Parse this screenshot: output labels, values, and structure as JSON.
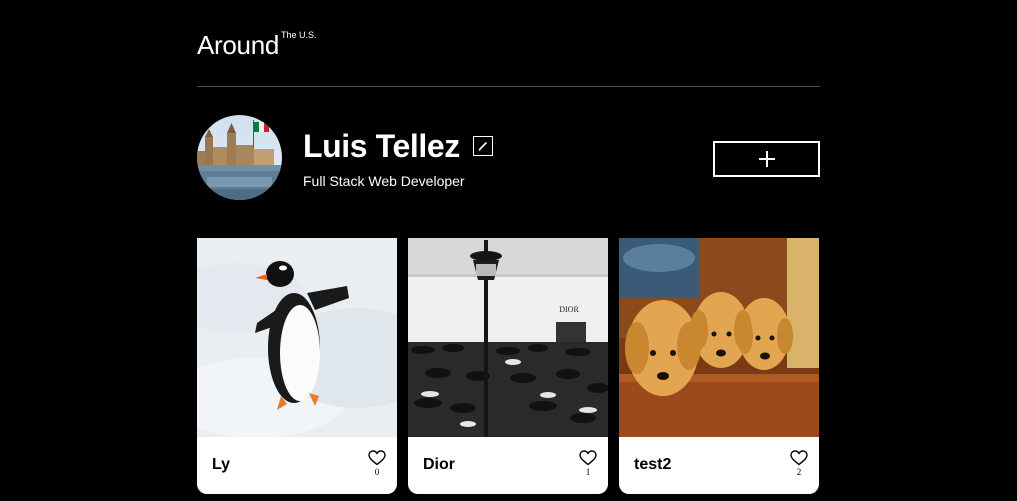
{
  "header": {
    "logo": "Around",
    "logo_sup": "The U.S."
  },
  "profile": {
    "name": "Luis Tellez",
    "about": "Full Stack Web Developer",
    "add_label": "+"
  },
  "cards": [
    {
      "title": "Ly",
      "likes": "0"
    },
    {
      "title": "Dior",
      "likes": "1"
    },
    {
      "title": "test2",
      "likes": "2"
    }
  ]
}
